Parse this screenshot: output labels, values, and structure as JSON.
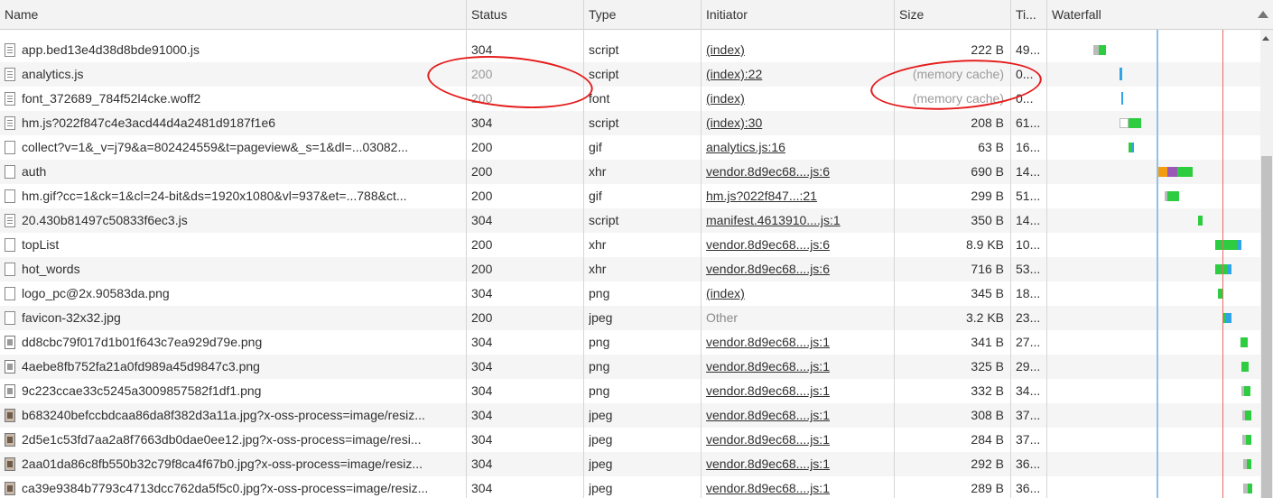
{
  "columns": {
    "name": "Name",
    "status": "Status",
    "type": "Type",
    "initiator": "Initiator",
    "size": "Size",
    "time": "Ti...",
    "waterfall": "Waterfall"
  },
  "colors": {
    "waiting": "#2ecc40",
    "download": "#2fa4e7",
    "blocked": "#f39c12",
    "ssl": "#9b59b6",
    "load_line": "#e46a6a",
    "dom_line": "#8fc1ea",
    "annotation": "#e51c1c"
  },
  "rows": [
    {
      "icon": "doc-file-icon",
      "name": "app.bed13e4d38d8bde91000.js",
      "status": "304",
      "type": "script",
      "initiator": "(index)",
      "size": "222 B",
      "time": "49...",
      "bars": [
        {
          "l": 1211,
          "w": 6,
          "c": "#bbbbbb"
        },
        {
          "l": 1217,
          "w": 8,
          "c": "#2ecc40"
        }
      ]
    },
    {
      "icon": "doc-file-icon",
      "name": "analytics.js",
      "status": "200",
      "type": "script",
      "initiator": "(index):22",
      "size": "(memory cache)",
      "time": "0...",
      "muted": true,
      "bars": [
        {
          "l": 1240,
          "w": 3,
          "c": "#2fa4e7",
          "thin": true
        }
      ]
    },
    {
      "icon": "doc-file-icon",
      "name": "font_372689_784f52l4cke.woff2",
      "status": "200",
      "type": "font",
      "initiator": "(index)",
      "size": "(memory cache)",
      "time": "0...",
      "muted": true,
      "bars": [
        {
          "l": 1242,
          "w": 2,
          "c": "#2fa4e7",
          "thin": true
        }
      ]
    },
    {
      "icon": "doc-file-icon",
      "name": "hm.js?022f847c4e3acd44d4a2481d9187f1e6",
      "status": "304",
      "type": "script",
      "initiator": "(index):30",
      "size": "208 B",
      "time": "61...",
      "bars": [
        {
          "l": 1240,
          "w": 10,
          "c": "#ffffff",
          "border": true
        },
        {
          "l": 1250,
          "w": 14,
          "c": "#2ecc40"
        }
      ]
    },
    {
      "icon": "blank-file-icon",
      "name": "collect?v=1&_v=j79&a=802424559&t=pageview&_s=1&dl=...03082...",
      "status": "200",
      "type": "gif",
      "initiator": "analytics.js:16",
      "size": "63 B",
      "time": "16...",
      "bars": [
        {
          "l": 1250,
          "w": 4,
          "c": "#2ecc40"
        },
        {
          "l": 1254,
          "w": 2,
          "c": "#2fa4e7"
        }
      ]
    },
    {
      "icon": "blank-file-icon",
      "name": "auth",
      "status": "200",
      "type": "xhr",
      "initiator": "vendor.8d9ec68....js:6",
      "size": "690 B",
      "time": "14...",
      "bars": [
        {
          "l": 1282,
          "w": 11,
          "c": "#f39c12"
        },
        {
          "l": 1293,
          "w": 11,
          "c": "#9b59b6"
        },
        {
          "l": 1304,
          "w": 17,
          "c": "#2ecc40"
        }
      ]
    },
    {
      "icon": "blank-file-icon",
      "name": "hm.gif?cc=1&ck=1&cl=24-bit&ds=1920x1080&vl=937&et=...788&ct...",
      "status": "200",
      "type": "gif",
      "initiator": "hm.js?022f847...:21",
      "size": "299 B",
      "time": "51...",
      "bars": [
        {
          "l": 1290,
          "w": 3,
          "c": "#bbbbbb"
        },
        {
          "l": 1293,
          "w": 13,
          "c": "#2ecc40"
        }
      ]
    },
    {
      "icon": "doc-file-icon",
      "name": "20.430b81497c50833f6ec3.js",
      "status": "304",
      "type": "script",
      "initiator": "manifest.4613910....js:1",
      "size": "350 B",
      "time": "14...",
      "bars": [
        {
          "l": 1327,
          "w": 5,
          "c": "#2ecc40"
        }
      ]
    },
    {
      "icon": "blank-file-icon",
      "name": "topList",
      "status": "200",
      "type": "xhr",
      "initiator": "vendor.8d9ec68....js:6",
      "size": "8.9 KB",
      "time": "10...",
      "bars": [
        {
          "l": 1346,
          "w": 25,
          "c": "#2ecc40"
        },
        {
          "l": 1371,
          "w": 4,
          "c": "#2fa4e7"
        }
      ]
    },
    {
      "icon": "blank-file-icon",
      "name": "hot_words",
      "status": "200",
      "type": "xhr",
      "initiator": "vendor.8d9ec68....js:6",
      "size": "716 B",
      "time": "53...",
      "bars": [
        {
          "l": 1346,
          "w": 14,
          "c": "#2ecc40"
        },
        {
          "l": 1360,
          "w": 4,
          "c": "#2fa4e7"
        }
      ]
    },
    {
      "icon": "blank-file-icon",
      "name": "logo_pc@2x.90583da.png",
      "status": "304",
      "type": "png",
      "initiator": "(index)",
      "size": "345 B",
      "time": "18...",
      "bars": [
        {
          "l": 1349,
          "w": 6,
          "c": "#2ecc40"
        }
      ]
    },
    {
      "icon": "blank-file-icon",
      "name": "favicon-32x32.jpg",
      "status": "200",
      "type": "jpeg",
      "initiator": "Other",
      "plainInitiator": true,
      "size": "3.2 KB",
      "time": "23...",
      "bars": [
        {
          "l": 1355,
          "w": 3,
          "c": "#2ecc40"
        },
        {
          "l": 1358,
          "w": 6,
          "c": "#2fa4e7"
        }
      ]
    },
    {
      "icon": "image-file-icon",
      "name": "dd8cbc79f017d1b01f643c7ea929d79e.png",
      "status": "304",
      "type": "png",
      "initiator": "vendor.8d9ec68....js:1",
      "size": "341 B",
      "time": "27...",
      "bars": [
        {
          "l": 1374,
          "w": 8,
          "c": "#2ecc40"
        }
      ]
    },
    {
      "icon": "image-file-icon",
      "name": "4aebe8fb752fa21a0fd989a45d9847c3.png",
      "status": "304",
      "type": "png",
      "initiator": "vendor.8d9ec68....js:1",
      "size": "325 B",
      "time": "29...",
      "bars": [
        {
          "l": 1375,
          "w": 8,
          "c": "#2ecc40"
        }
      ]
    },
    {
      "icon": "image-file-icon",
      "name": "9c223ccae33c5245a3009857582f1df1.png",
      "status": "304",
      "type": "png",
      "initiator": "vendor.8d9ec68....js:1",
      "size": "332 B",
      "time": "34...",
      "bars": [
        {
          "l": 1375,
          "w": 3,
          "c": "#bbbbbb"
        },
        {
          "l": 1378,
          "w": 7,
          "c": "#2ecc40"
        }
      ]
    },
    {
      "icon": "photo-file-icon",
      "name": "b683240befccbdcaa86da8f382d3a11a.jpg?x-oss-process=image/resiz...",
      "status": "304",
      "type": "jpeg",
      "initiator": "vendor.8d9ec68....js:1",
      "size": "308 B",
      "time": "37...",
      "bars": [
        {
          "l": 1376,
          "w": 3,
          "c": "#bbbbbb"
        },
        {
          "l": 1379,
          "w": 7,
          "c": "#2ecc40"
        }
      ]
    },
    {
      "icon": "photo-file-icon",
      "name": "2d5e1c53fd7aa2a8f7663db0dae0ee12.jpg?x-oss-process=image/resi...",
      "status": "304",
      "type": "jpeg",
      "initiator": "vendor.8d9ec68....js:1",
      "size": "284 B",
      "time": "37...",
      "bars": [
        {
          "l": 1376,
          "w": 4,
          "c": "#bbbbbb"
        },
        {
          "l": 1380,
          "w": 6,
          "c": "#2ecc40"
        }
      ]
    },
    {
      "icon": "photo-file-icon",
      "name": "2aa01da86c8fb550b32c79f8ca4f67b0.jpg?x-oss-process=image/resiz...",
      "status": "304",
      "type": "jpeg",
      "initiator": "vendor.8d9ec68....js:1",
      "size": "292 B",
      "time": "36...",
      "bars": [
        {
          "l": 1377,
          "w": 4,
          "c": "#bbbbbb"
        },
        {
          "l": 1381,
          "w": 5,
          "c": "#2ecc40"
        }
      ]
    },
    {
      "icon": "photo-file-icon",
      "name": "ca39e9384b7793c4713dcc762da5f5c0.jpg?x-oss-process=image/resiz...",
      "status": "304",
      "type": "jpeg",
      "initiator": "vendor.8d9ec68....js:1",
      "size": "289 B",
      "time": "36...",
      "bars": [
        {
          "l": 1377,
          "w": 5,
          "c": "#bbbbbb"
        },
        {
          "l": 1382,
          "w": 5,
          "c": "#2ecc40"
        }
      ]
    }
  ]
}
